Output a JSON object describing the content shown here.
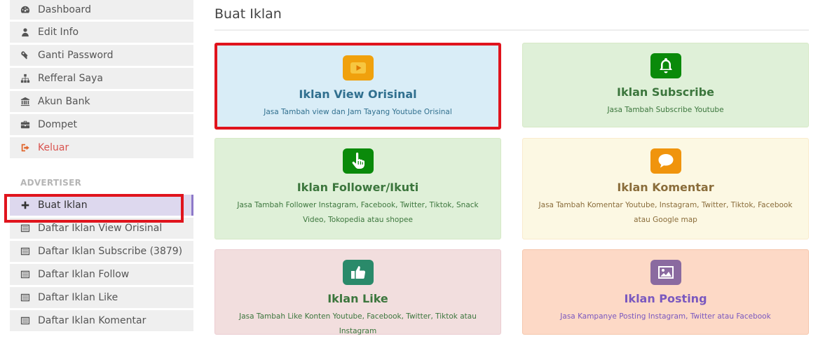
{
  "sidebar": {
    "items": [
      {
        "label": "Dashboard",
        "icon": "dashboard-icon"
      },
      {
        "label": "Edit Info",
        "icon": "user-icon"
      },
      {
        "label": "Ganti Password",
        "icon": "key-icon"
      },
      {
        "label": "Refferal Saya",
        "icon": "sitemap-icon"
      },
      {
        "label": "Akun Bank",
        "icon": "bank-icon"
      },
      {
        "label": "Dompet",
        "icon": "briefcase-icon"
      },
      {
        "label": "Keluar",
        "icon": "sign-out-icon"
      }
    ],
    "section_title": "ADVERTISER",
    "advertiser_items": [
      {
        "label": "Buat Iklan",
        "icon": "plus-icon",
        "active": true
      },
      {
        "label": "Daftar Iklan View Orisinal",
        "icon": "list-icon"
      },
      {
        "label": "Daftar Iklan Subscribe (3879)",
        "icon": "list-icon"
      },
      {
        "label": "Daftar Iklan Follow",
        "icon": "list-icon"
      },
      {
        "label": "Daftar Iklan Like",
        "icon": "list-icon"
      },
      {
        "label": "Daftar Iklan Komentar",
        "icon": "list-icon"
      }
    ]
  },
  "main": {
    "title": "Buat Iklan",
    "cards": [
      {
        "title": "Iklan View Orisinal",
        "desc": "Jasa Tambah view dan Jam Tayang Youtube Orisinal",
        "icon": "youtube-play-icon",
        "icon_color": "#f0a10d"
      },
      {
        "title": "Iklan Subscribe",
        "desc": "Jasa Tambah Subscribe Youtube",
        "icon": "bell-icon",
        "icon_color": "#0a8a0a"
      },
      {
        "title": "Iklan Follower/Ikuti",
        "desc": "Jasa Tambah Follower Instagram, Facebook, Twitter, Tiktok, Snack Video, Tokopedia atau shopee",
        "icon": "pointer-hand-icon",
        "icon_color": "#0a8a0a"
      },
      {
        "title": "Iklan Komentar",
        "desc": "Jasa Tambah Komentar Youtube, Instagram, Twitter, Tiktok, Facebook atau Google map",
        "icon": "comment-icon",
        "icon_color": "#f0940d"
      },
      {
        "title": "Iklan Like",
        "desc": "Jasa Tambah Like Konten Youtube, Facebook, Twitter, Tiktok atau Instagram",
        "icon": "thumbs-up-icon",
        "icon_color": "#2a8a6a"
      },
      {
        "title": "Iklan Posting",
        "desc": "Jasa Kampanye Posting Instagram, Twitter atau Facebook",
        "icon": "image-icon",
        "icon_color": "#8a6aa0"
      }
    ]
  },
  "colors": {
    "highlight": "#e0141d",
    "active_nav": "#ddd8ee",
    "active_nav_border": "#8d79c9"
  }
}
